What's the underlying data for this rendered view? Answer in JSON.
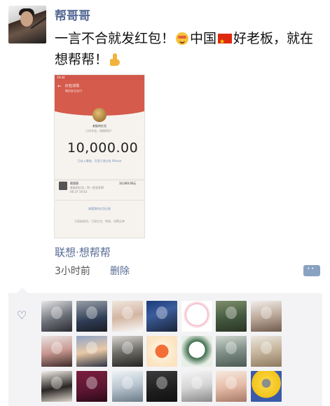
{
  "post": {
    "author": "帮哥哥",
    "text_part1": "一言不合就发红包！",
    "text_part2": "中国",
    "text_part3": "好老板，就在想帮帮！",
    "emoji_1": "smiling-face-with-heart-eyes",
    "emoji_2": "china-flag",
    "emoji_3": "thumbs-up",
    "source": "联想·想帮帮",
    "time": "3小时前",
    "delete_label": "删除"
  },
  "screenshot": {
    "status": "19:44",
    "header_title": "红包详情",
    "header_sub": "微信安全支付",
    "sender": "老板的红包",
    "wish": "工作辛苦，再接再厉！",
    "amount": "10,000.00",
    "unit": "元",
    "note": "已存入零钱，可用于发红包 iPhone",
    "record_name": "帮哥哥",
    "record_amount": "10,000.00元",
    "record_desc": "老板的红包，你一定会发财",
    "record_time": "06:37 19:43",
    "link": "查看我的红包记录",
    "footer": "可直接使用，可发红包、转账，消费买单"
  },
  "likes": {
    "count": 24
  },
  "colors": {
    "link_blue": "#576b95",
    "red_packet": "#d55b4d",
    "likes_bg": "#f3f3f5"
  }
}
